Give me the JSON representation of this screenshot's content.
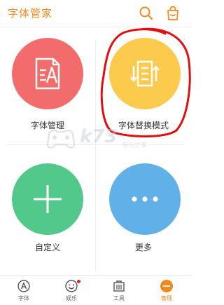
{
  "header": {
    "title": "字体管家"
  },
  "colors": {
    "accent": "#f18a1e",
    "tile_red": "#f26c6c",
    "tile_yellow": "#fccb4e",
    "tile_green": "#52c98a",
    "tile_blue": "#62b0e8",
    "annotation_red": "#e01010"
  },
  "grid": {
    "items": [
      {
        "label": "字体管理",
        "icon": "font-document-icon"
      },
      {
        "label": "字体替换模式",
        "icon": "swap-list-icon"
      },
      {
        "label": "自定义",
        "icon": "plus-icon"
      },
      {
        "label": "更多",
        "icon": "more-dots-icon"
      }
    ]
  },
  "watermark": {
    "text": "k73",
    "sub": "电玩之家"
  },
  "tabbar": {
    "items": [
      {
        "label": "字体",
        "icon": "font-a-icon"
      },
      {
        "label": "娱乐",
        "icon": "smile-icon",
        "has_badge": true
      },
      {
        "label": "工具",
        "icon": "toolbox-icon"
      },
      {
        "label": "管理",
        "icon": "manage-icon",
        "active": true
      }
    ]
  }
}
